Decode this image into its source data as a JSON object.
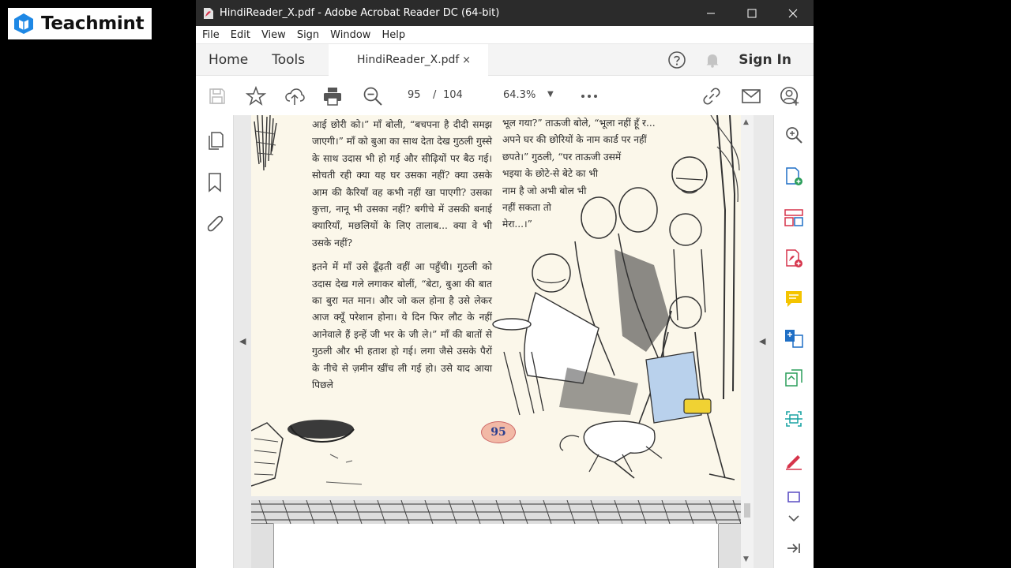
{
  "brand": {
    "name": "Teachmint"
  },
  "window": {
    "title": "HindiReader_X.pdf - Adobe Acrobat Reader DC (64-bit)"
  },
  "menu": [
    "File",
    "Edit",
    "View",
    "Sign",
    "Window",
    "Help"
  ],
  "tabs": {
    "home": "Home",
    "tools": "Tools",
    "document": "HindiReader_X.pdf",
    "close": "×",
    "sign_in": "Sign In"
  },
  "toolbar": {
    "page_current": "95",
    "page_separator": "/",
    "page_total": "104",
    "zoom": "64.3%"
  },
  "page": {
    "left_paragraphs": [
      "आई छोरी को।” माँ बोली, “बचपना है दीदी समझ जाएगी।” माँ को बुआ का साथ देता देख गुठली गुस्से के साथ उदास भी हो गई और सीढ़ियों पर बैठ गई। सोचती रही क्या यह घर उसका नहीं? क्या उसके आम की कैरियाँ वह कभी नहीं खा पाएगी? उसका कुत्ता, नानू भी उसका नहीं? बगीचे में उसकी बनाई क्यारियाँ, मछलियों के लिए तालाब... क्या वे भी उसके नहीं?",
      "इतने में माँ उसे ढूँढ़ती वहीं आ पहुँची। गुठली को उदास देख गले लगाकर बोलीं, “बेटा, बुआ की बात का बुरा मत मान। और जो कल होना है उसे लेकर आज क्यूँ परेशान होना। ये दिन फिर लौट के नहीं आनेवाले हैं इन्हें जी भर के जी ले।” माँ की बातों से गुठली और भी हताश हो गई। लगा जैसे उसके पैरों के नीचे से ज़मीन खींच ली गई हो। उसे याद आया पिछले"
    ],
    "right_lines": [
      "भूल गया?” ताऊजी बोले, “भूला नहीं हूँ र...",
      "अपने घर की छोरियों के नाम कार्ड पर नहीं",
      "छपते।” गुठली, “पर ताऊजी उसमें",
      "भइया के छोटे-से बेटे का भी",
      "नाम है जो अभी बोल भी",
      "नहीं सकता तो",
      "मेरा...।”"
    ],
    "page_number": "95"
  },
  "colors": {
    "titlebar": "#2b2b2b",
    "page_bg": "#fbf7ea",
    "accent_blue": "#1f6fc5",
    "accent_red": "#d6344b"
  },
  "icons": {
    "toolbar": [
      "save-icon",
      "star-icon",
      "upload-icon",
      "print-icon",
      "zoom-out-icon",
      "more-icon",
      "share-link-icon",
      "mail-icon",
      "account-icon"
    ],
    "left_rail": [
      "pages-icon",
      "bookmark-icon",
      "attachment-icon"
    ],
    "right_rail": [
      "search-icon",
      "export-pdf-icon",
      "organize-pages-icon",
      "create-pdf-icon",
      "comment-icon",
      "combine-files-icon",
      "compress-icon",
      "scan-icon",
      "fill-sign-icon",
      "protect-icon",
      "collapse-panel-icon"
    ]
  }
}
